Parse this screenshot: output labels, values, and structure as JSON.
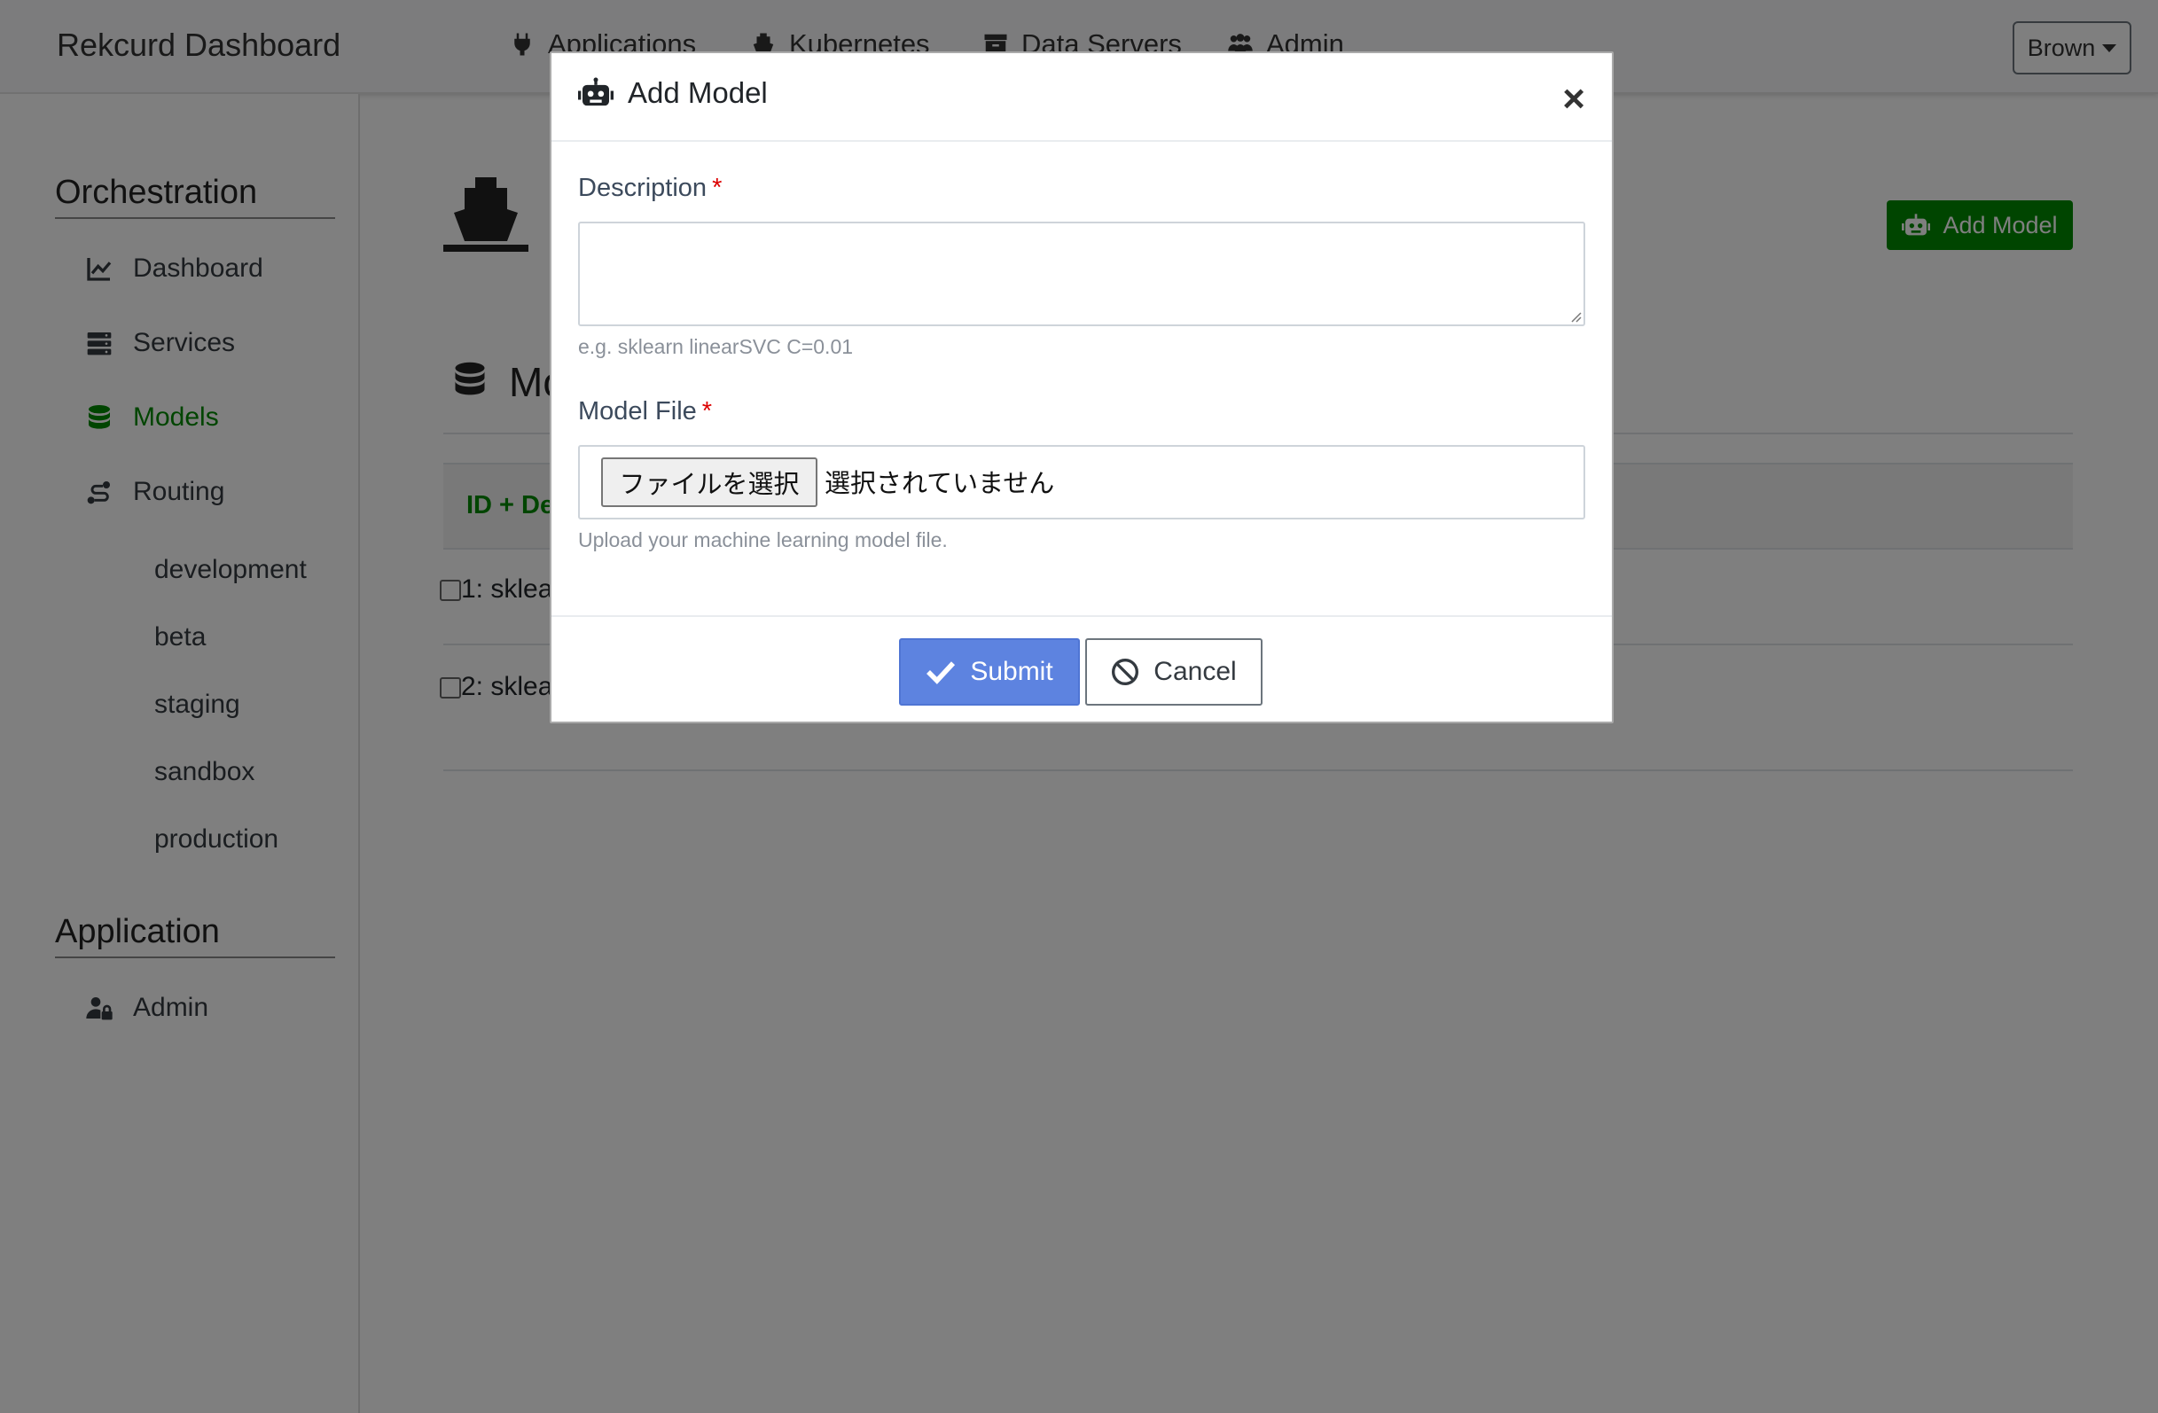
{
  "navbar": {
    "brand": "Rekcurd Dashboard",
    "links": [
      "Applications",
      "Kubernetes",
      "Data Servers",
      "Admin"
    ],
    "user": "Brown"
  },
  "sidebar": {
    "section1": "Orchestration",
    "items": [
      "Dashboard",
      "Services",
      "Models",
      "Routing"
    ],
    "active": "Models",
    "routing_subitems": [
      "development",
      "beta",
      "staging",
      "sandbox",
      "production"
    ],
    "section2": "Application",
    "app_items": [
      "Admin"
    ]
  },
  "main": {
    "add_model_button": "Add Model",
    "header_partial": "Mo",
    "table_header_partial": "ID + De",
    "rows": [
      "1: sklea",
      "2: sklea"
    ]
  },
  "modal": {
    "title": "Add Model",
    "close": "×",
    "description_label": "Description",
    "required_mark": "*",
    "description_help": "e.g. sklearn linearSVC C=0.01",
    "model_file_label": "Model File",
    "file_button": "ファイルを選択",
    "file_status": "選択されていません",
    "file_help": "Upload your machine learning model file.",
    "submit": "Submit",
    "cancel": "Cancel"
  },
  "colors": {
    "accent_green": "#008a00",
    "submit_blue": "#5d83e0",
    "required_red": "#dc0000"
  }
}
